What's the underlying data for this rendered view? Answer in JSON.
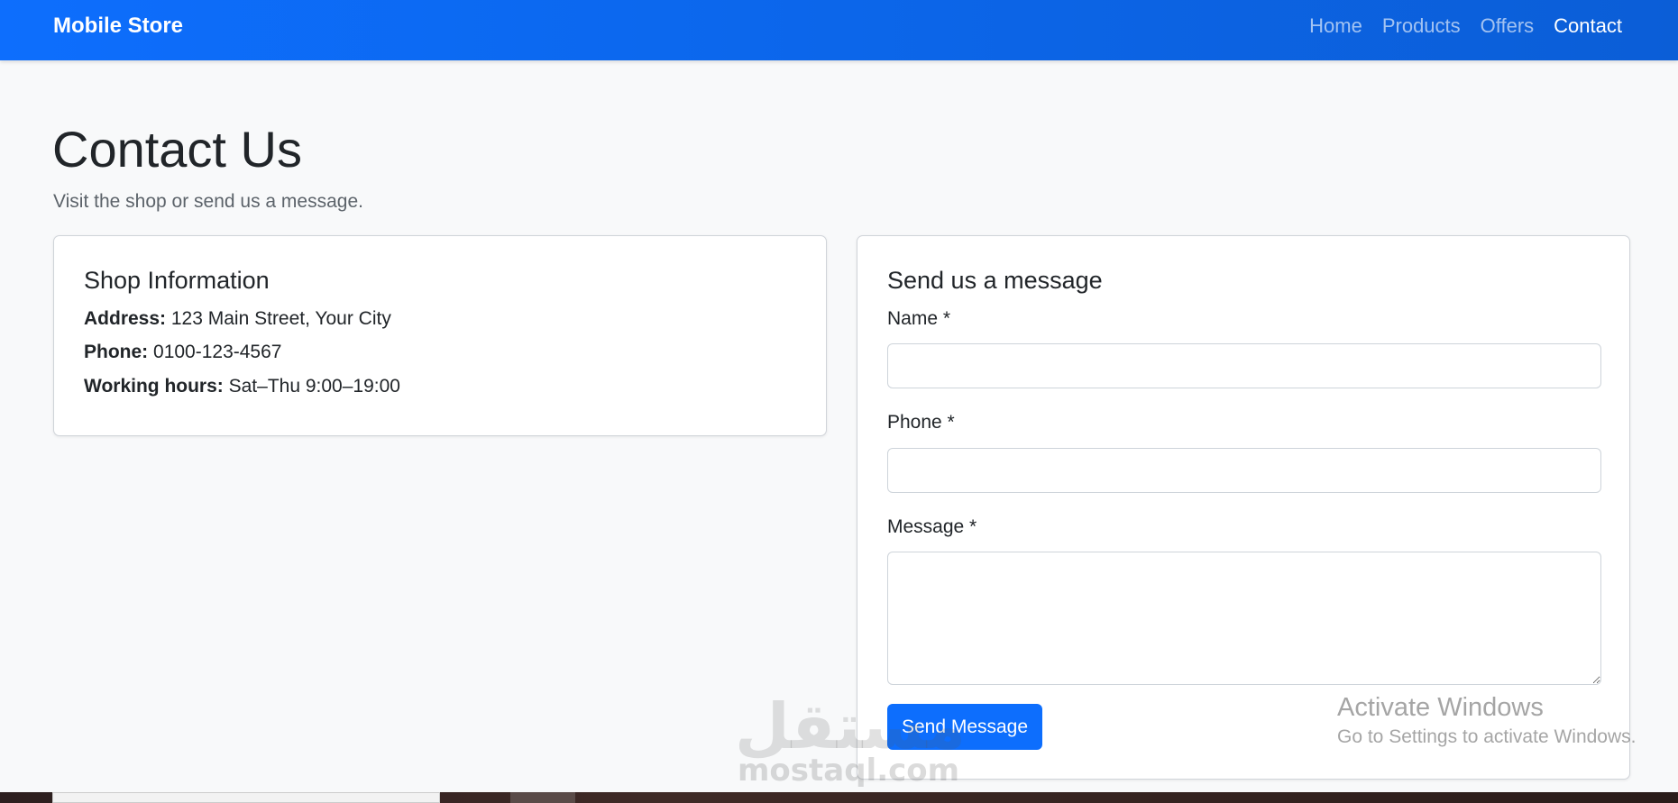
{
  "nav": {
    "brand": "Mobile Store",
    "links": [
      "Home",
      "Products",
      "Offers",
      "Contact"
    ],
    "active": "Contact"
  },
  "page": {
    "title": "Contact Us",
    "subtitle": "Visit the shop or send us a message."
  },
  "shop_info": {
    "title": "Shop Information",
    "address_label": "Address:",
    "address_value": "123 Main Street, Your City",
    "phone_label": "Phone:",
    "phone_value": "0100-123-4567",
    "hours_label": "Working hours:",
    "hours_value": "Sat–Thu 9:00–19:00"
  },
  "form": {
    "title": "Send us a message",
    "name_label": "Name *",
    "phone_label": "Phone *",
    "message_label": "Message *",
    "name_value": "",
    "phone_value": "",
    "message_value": "",
    "submit_label": "Send Message"
  },
  "overlay": {
    "watermark_logo": "مستقل",
    "watermark_domain": "mostaql.com",
    "activate_title": "Activate Windows",
    "activate_sub": "Go to Settings to activate Windows."
  },
  "colors": {
    "primary": "#0d6efd",
    "background": "#f8f9fa",
    "text": "#212529"
  }
}
